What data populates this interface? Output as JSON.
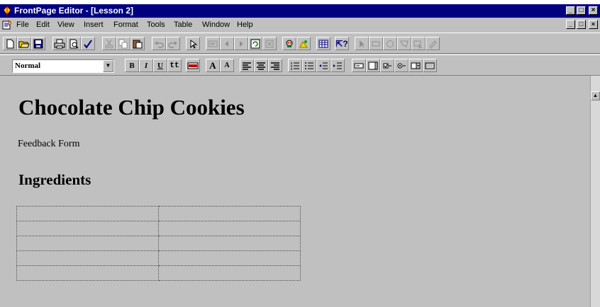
{
  "window": {
    "title": "FrontPage Editor - [Lesson 2]",
    "controls": {
      "minimize": "_",
      "maximize": "□",
      "close": "×"
    }
  },
  "menu": {
    "items": [
      "File",
      "Edit",
      "View",
      "Insert",
      "Format",
      "Tools",
      "Table",
      "Window",
      "Help"
    ]
  },
  "toolbar_standard": {
    "buttons": [
      "new-page",
      "open",
      "save",
      "print",
      "print-preview",
      "spelling",
      "cut",
      "copy",
      "paste",
      "undo",
      "redo",
      "show-frontpage-explorer",
      "show-to-do-list",
      "back",
      "forward",
      "refresh",
      "stop",
      "insert-webbot",
      "insert-image",
      "show-format-marks",
      "help",
      "select",
      "rectangle",
      "circle",
      "polygon",
      "highlight-hotspots",
      "pencil"
    ]
  },
  "toolbar_format": {
    "style_value": "Normal",
    "text_buttons": {
      "bold": "B",
      "italic": "I",
      "underline": "U",
      "fixed_width": "tt",
      "increase_size": "A",
      "decrease_size": "A"
    }
  },
  "document": {
    "heading1": "Chocolate Chip Cookies",
    "link_text": "Feedback Form",
    "heading2": "Ingredients",
    "table": {
      "rows": 5,
      "columns": 2
    }
  },
  "colors": {
    "titlebar": "#000080",
    "face": "#c0c0c0"
  }
}
